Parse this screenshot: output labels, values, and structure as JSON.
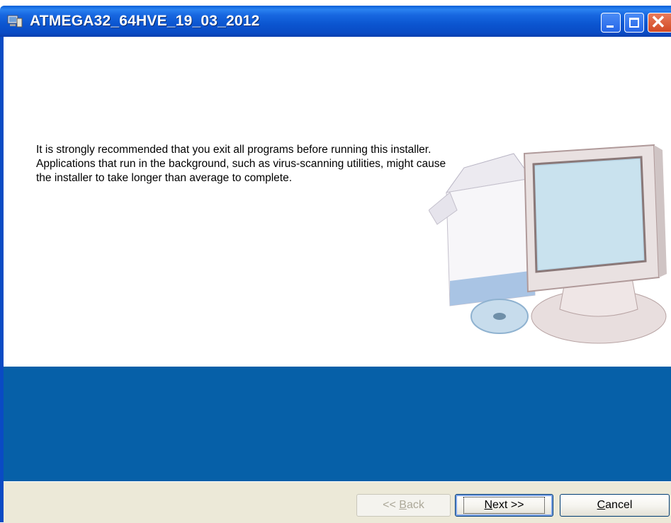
{
  "window": {
    "title": "ATMEGA32_64HVE_19_03_2012",
    "controls": [
      "minimize",
      "maximize",
      "close"
    ]
  },
  "content": {
    "message": "It is strongly recommended that you exit all programs before running this installer. Applications that run in the background, such as virus-scanning utilities, might cause the installer to take longer than average to complete.",
    "illustration_icon": "computer-with-box-and-disc-icon"
  },
  "buttons": {
    "back": {
      "prefix": "<< ",
      "accel": "B",
      "rest": "ack",
      "enabled": false
    },
    "next": {
      "accel": "N",
      "rest": "ext >>",
      "enabled": true,
      "default": true
    },
    "cancel": {
      "accel": "C",
      "rest": "ancel",
      "enabled": true
    }
  },
  "colors": {
    "titlebar": "#0a55d0",
    "band": "#0660a8",
    "button_bar": "#ece9d8"
  }
}
